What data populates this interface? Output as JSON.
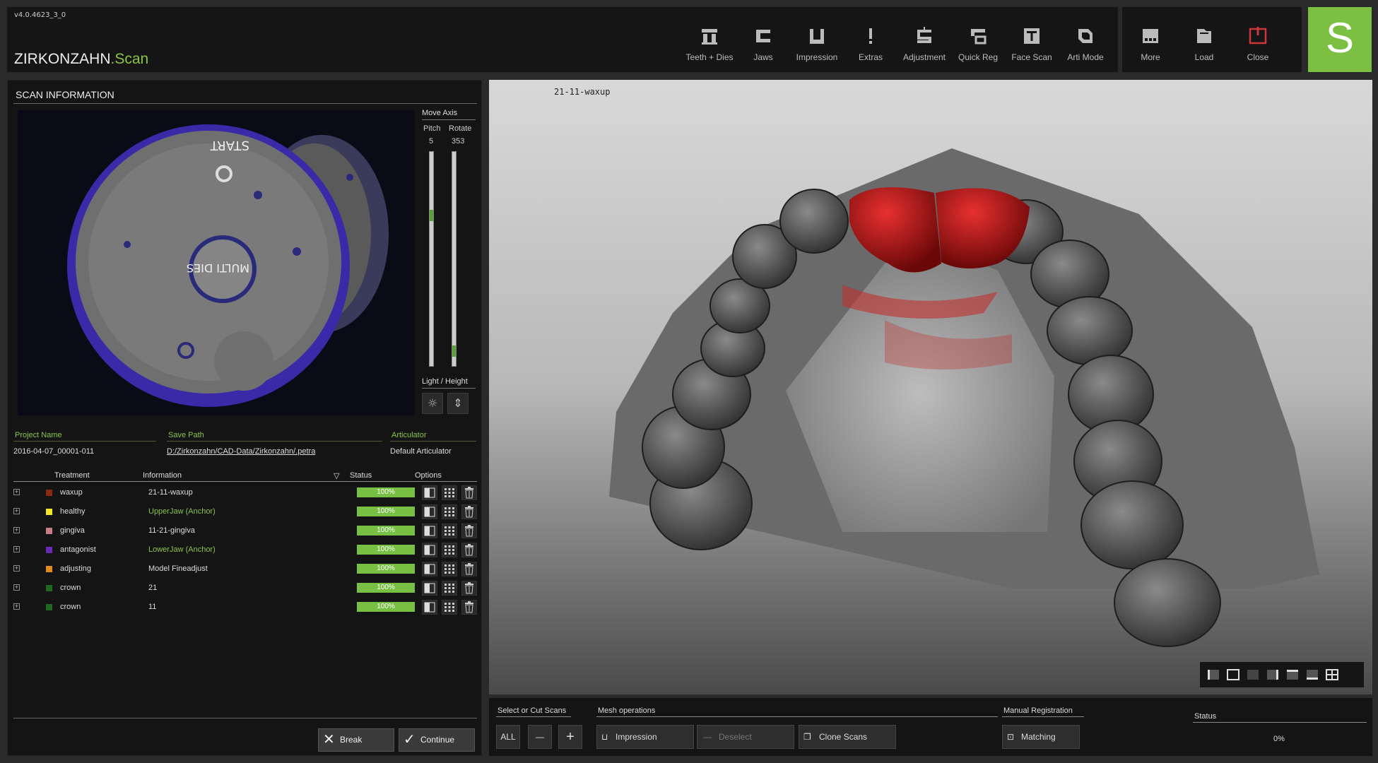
{
  "app": {
    "version": "v4.0.4623_3_0",
    "brand_main": "ZIRKONZAHN",
    "brand_sub": ".Scan",
    "logo_letter": "S",
    "accent": "#7cc043"
  },
  "toolbar": {
    "items": [
      {
        "label": "Teeth + Dies",
        "icon": "teeth-dies-icon"
      },
      {
        "label": "Jaws",
        "icon": "jaws-icon"
      },
      {
        "label": "Impression",
        "icon": "impression-icon"
      },
      {
        "label": "Extras",
        "icon": "extras-icon"
      },
      {
        "label": "Adjustment",
        "icon": "adjustment-icon"
      },
      {
        "label": "Quick Reg",
        "icon": "quick-reg-icon"
      },
      {
        "label": "Face Scan",
        "icon": "face-scan-icon"
      },
      {
        "label": "Arti Mode",
        "icon": "arti-mode-icon"
      }
    ],
    "right": [
      {
        "label": "More",
        "icon": "more-icon"
      },
      {
        "label": "Load",
        "icon": "load-icon"
      },
      {
        "label": "Close",
        "icon": "power-icon",
        "color": "#c8383a"
      }
    ]
  },
  "scan_info": {
    "title": "SCAN INFORMATION",
    "camera_text_top": "START",
    "camera_text_center": "MULTI DIES",
    "move_axis": {
      "title": "Move Axis",
      "pitch_label": "Pitch",
      "rotate_label": "Rotate",
      "pitch": "5",
      "rotate": "353"
    },
    "light_height": "Light / Height",
    "project_name_label": "Project Name",
    "project_name": "2016-04-07_00001-011",
    "save_path_label": "Save Path",
    "save_path": "D:/Zirkonzahn/CAD-Data/Zirkonzahn/.petra",
    "articulator_label": "Articulator",
    "articulator": "Default Articulator",
    "columns": {
      "treatment": "Treatment",
      "information": "Information",
      "status": "Status",
      "options": "Options"
    },
    "rows": [
      {
        "treatment": "waxup",
        "color": "#8b2a14",
        "info": "21-11-waxup",
        "info_color": "#dddddd",
        "status": "100%"
      },
      {
        "treatment": "healthy",
        "color": "#f2e62a",
        "info": "UpperJaw (Anchor)",
        "info_color": "#8bc34a",
        "status": "100%"
      },
      {
        "treatment": "gingiva",
        "color": "#c87c84",
        "info": "11-21-gingiva",
        "info_color": "#dddddd",
        "status": "100%"
      },
      {
        "treatment": "antagonist",
        "color": "#6a2ab8",
        "info": "LowerJaw (Anchor)",
        "info_color": "#8bc34a",
        "status": "100%"
      },
      {
        "treatment": "adjusting",
        "color": "#e08a20",
        "info": "Model Fineadjust",
        "info_color": "#dddddd",
        "status": "100%"
      },
      {
        "treatment": "crown",
        "color": "#1f6a1f",
        "info": "21",
        "info_color": "#dddddd",
        "status": "100%"
      },
      {
        "treatment": "crown",
        "color": "#1f6a1f",
        "info": "11",
        "info_color": "#dddddd",
        "status": "100%"
      }
    ],
    "break_label": "Break",
    "continue_label": "Continue"
  },
  "viewport": {
    "label": "21-11-waxup"
  },
  "bottom": {
    "select_title": "Select or Cut Scans",
    "all_label": "ALL",
    "minus_label": "—",
    "plus_label": "+",
    "mesh_title": "Mesh operations",
    "impression_label": "Impression",
    "deselect_label": "Deselect",
    "clone_label": "Clone Scans",
    "manual_title": "Manual Registration",
    "matching_label": "Matching",
    "status_title": "Status",
    "status_value": "0%"
  }
}
